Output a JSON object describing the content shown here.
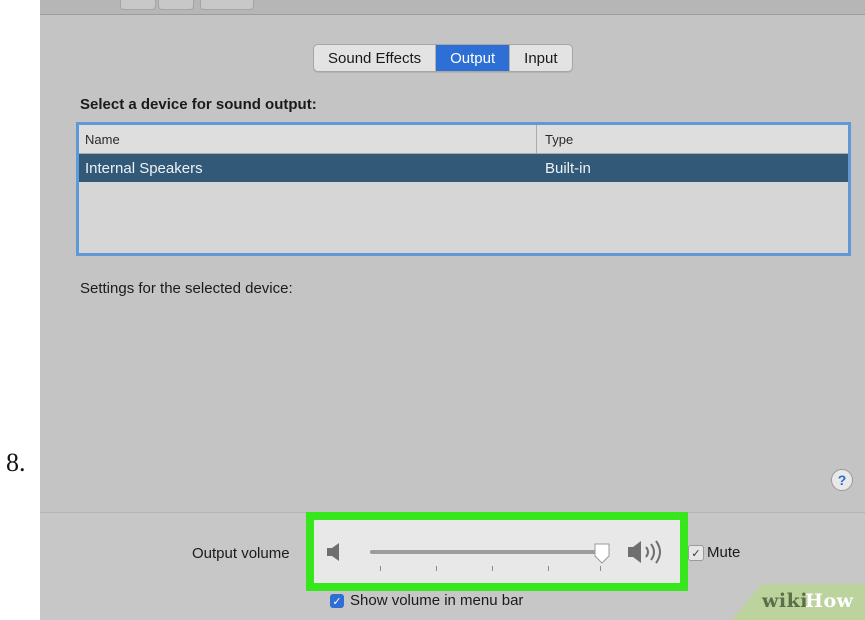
{
  "step_number": "8.",
  "tabs": [
    {
      "label": "Sound Effects",
      "active": false
    },
    {
      "label": "Output",
      "active": true
    },
    {
      "label": "Input",
      "active": false
    }
  ],
  "device_section": {
    "title": "Select a device for sound output:",
    "columns": [
      "Name",
      "Type"
    ],
    "rows": [
      {
        "name": "Internal Speakers",
        "type": "Built-in",
        "selected": true
      }
    ]
  },
  "settings_label": "Settings for the selected device:",
  "help_label": "?",
  "volume": {
    "label": "Output volume",
    "level": 0.98,
    "low_icon": "speaker-low-icon",
    "high_icon": "speaker-high-icon"
  },
  "mute": {
    "label": "Mute",
    "checked": true,
    "check_glyph": "✓"
  },
  "menubar": {
    "label": "Show volume in menu bar",
    "checked": true,
    "check_glyph": "✓"
  },
  "watermark": {
    "part1": "wiki",
    "part2": "How"
  },
  "colors": {
    "accent": "#2d6fd4",
    "selected_row": "#325a78",
    "highlight": "#37e61c",
    "panel_bg": "#c4c4c4"
  }
}
